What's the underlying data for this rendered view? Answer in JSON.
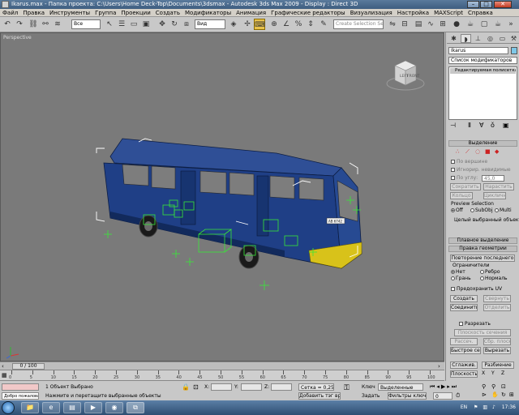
{
  "window": {
    "title": "Ikarus.max     - Папка проекта: C:\\Users\\Home Deck-Top\\Documents\\3dsmax      - Autodesk 3ds Max  2009       - Display : Direct 3D",
    "min": "–",
    "max": "□",
    "close": "✕"
  },
  "menu": [
    "Файл",
    "Правка",
    "Инструменты",
    "Группа",
    "Проекции",
    "Создать",
    "Модификаторы",
    "Анимация",
    "Графические редакторы",
    "Визуализация",
    "Настройка",
    "MAXScript",
    "Справка"
  ],
  "toolbar": {
    "selection_filter": "Все",
    "ref_coord": "Вид",
    "named_selection": "Create Selection Set"
  },
  "viewport": {
    "label": "Perspective",
    "viewcube_left": "LEFT",
    "viewcube_front": "FRONT",
    "plate": "AB 6742",
    "bg": "#7a7a7a"
  },
  "cmdpanel": {
    "object_name": "Ikarus",
    "modifier_list": "Список модификаторов",
    "stack_item": "Редактируемая полисетка",
    "selection_rollout": "Выделение",
    "by_vertex": "По вершине",
    "ignore_backfacing": "Игнорир. невидимые",
    "by_angle": "По углу:",
    "angle_value": "45,0",
    "shrink": "Сократить",
    "grow": "Нарастить",
    "ring": "Кольцо",
    "loop": "Цикличн.",
    "preview_selection": "Preview Selection",
    "preview_off": "Off",
    "preview_subobj": "SubObj",
    "preview_multi": "Multi",
    "whole_selected": "Целый выбранный объект",
    "soft_selection": "Плавное выделение",
    "edit_geometry": "Правка геометрии",
    "repeat_last": "Повторение последнего",
    "constraints": "Ограничители",
    "c_none": "Нет",
    "c_edge": "Ребро",
    "c_face": "Грань",
    "c_normal": "Нормаль",
    "preserve_uvs": "Предохранить UV",
    "create": "Создать",
    "collapse": "Свернуть",
    "attach": "Соединить",
    "detach": "Отделить",
    "slice_plane": "Разрезать",
    "slice_section": "Плоскость сечения",
    "slice": "Рассеч.",
    "reset_plane": "Сбр. плоскость",
    "quickslice": "Быстрое сечен.",
    "cut": "Вырезать",
    "msmooth": "Сглажив.",
    "tessellate": "Разбиение",
    "make_planar": "Плоскость",
    "x": "X",
    "y": "Y",
    "z": "Z"
  },
  "timeline": {
    "frame": "0 / 100",
    "ticks": [
      "0",
      "5",
      "10",
      "15",
      "20",
      "25",
      "30",
      "35",
      "40",
      "45",
      "50",
      "55",
      "60",
      "65",
      "70",
      "75",
      "80",
      "85",
      "90",
      "95",
      "100"
    ]
  },
  "status": {
    "selected": "1 Объект Выбрано",
    "prompt": "Нажмите и перетащите выбранные объекты",
    "maxscript": "Добро пожаловать в MAXScript",
    "x_label": "X:",
    "y_label": "Y:",
    "z_label": "Z:",
    "grid": "Сетка = 0,254m",
    "add_time_tag": "Добавить тэг врем",
    "key": "Ключ",
    "set_key": "Задать",
    "key_filter_dropdown": "Выделенные",
    "key_filters": "Фильтры ключей",
    "frame_value": "0"
  },
  "taskbar": {
    "lang": "EN",
    "time": "17:36"
  },
  "colors": {
    "bus_body": "#1f3f86",
    "bus_dark": "#122a5c",
    "helper_green": "#38e838",
    "bbox_white": "#ffffff",
    "bus_yellow": "#d8c21a",
    "cmd_bg": "#c8c8c8"
  }
}
